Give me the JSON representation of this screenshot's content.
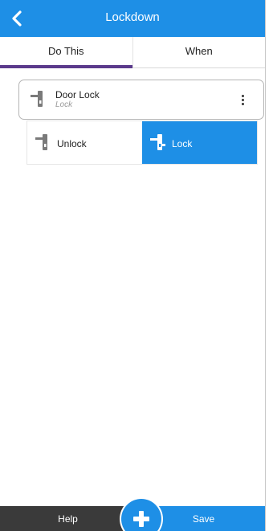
{
  "header": {
    "title": "Lockdown",
    "back_icon": "chevron-left-icon"
  },
  "tabs": [
    {
      "label": "Do This",
      "active": true
    },
    {
      "label": "When",
      "active": false
    }
  ],
  "device": {
    "name": "Door Lock",
    "state": "Lock",
    "icon": "door-lock-icon",
    "menu_icon": "more-vertical-icon"
  },
  "options": [
    {
      "label": "Unlock",
      "selected": false,
      "icon": "door-lock-icon"
    },
    {
      "label": "Lock",
      "selected": true,
      "icon": "door-lock-icon"
    }
  ],
  "footer": {
    "help_label": "Help",
    "save_label": "Save",
    "add_icon": "plus-icon"
  },
  "colors": {
    "accent": "#1e8fe6",
    "tab_indicator": "#5b3a8c",
    "footer_dark": "#3a3a3a"
  }
}
